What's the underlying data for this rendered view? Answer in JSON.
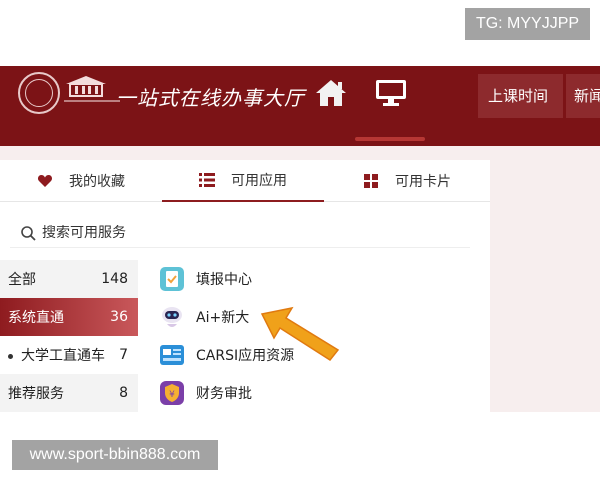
{
  "overlay": {
    "tg_label": "TG: MYYJJPP",
    "site_url": "www.sport-bbin888.com"
  },
  "header": {
    "title": "一站式在线办事大厅",
    "buttons": [
      "上课时间",
      "新闻"
    ]
  },
  "tabs": [
    {
      "label": "我的收藏",
      "icon": "heart-icon"
    },
    {
      "label": "可用应用",
      "icon": "list-icon",
      "active": true
    },
    {
      "label": "可用卡片",
      "icon": "grid-icon"
    }
  ],
  "search": {
    "placeholder": "搜索可用服务"
  },
  "categories": [
    {
      "label": "全部",
      "count": "148"
    },
    {
      "label": "系统直通",
      "count": "36",
      "active": true
    },
    {
      "label": "大学工直通车",
      "count": "7"
    },
    {
      "label": "推荐服务",
      "count": "8"
    }
  ],
  "apps": [
    {
      "label": "填报中心",
      "icon": "form-fill-icon"
    },
    {
      "label": "Ai+新大",
      "icon": "robot-icon"
    },
    {
      "label": "CARSI应用资源",
      "icon": "resource-card-icon"
    },
    {
      "label": "财务审批",
      "icon": "finance-shield-icon"
    }
  ],
  "colors": {
    "brand": "#7c1316",
    "accent": "#8e1b1f",
    "arrow": "#f0a11a"
  }
}
